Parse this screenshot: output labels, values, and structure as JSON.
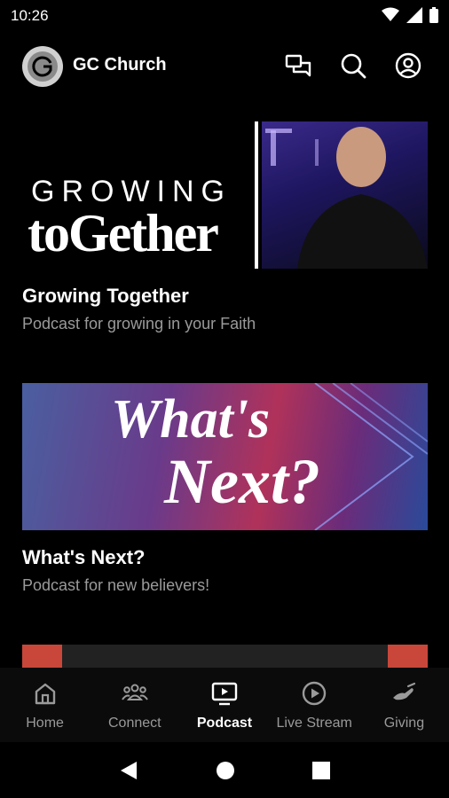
{
  "status_bar": {
    "time": "10:26"
  },
  "app_bar": {
    "title": "GC Church"
  },
  "podcasts": [
    {
      "title": "Growing Together",
      "description": "Podcast for growing in your Faith",
      "art_line1": "GROWING",
      "art_line2": "toGether"
    },
    {
      "title": "What's Next?",
      "description": "Podcast for new believers!",
      "art_line1": "What's",
      "art_line2": "Next?"
    }
  ],
  "bottom_nav": {
    "items": [
      {
        "label": "Home",
        "icon": "home-icon"
      },
      {
        "label": "Connect",
        "icon": "people-icon"
      },
      {
        "label": "Podcast",
        "icon": "tv-play-icon"
      },
      {
        "label": "Live Stream",
        "icon": "play-circle-icon"
      },
      {
        "label": "Giving",
        "icon": "hand-icon"
      }
    ],
    "active_index": 2
  },
  "colors": {
    "background": "#000000",
    "muted_text": "#9a9a9a",
    "active": "#ffffff"
  }
}
